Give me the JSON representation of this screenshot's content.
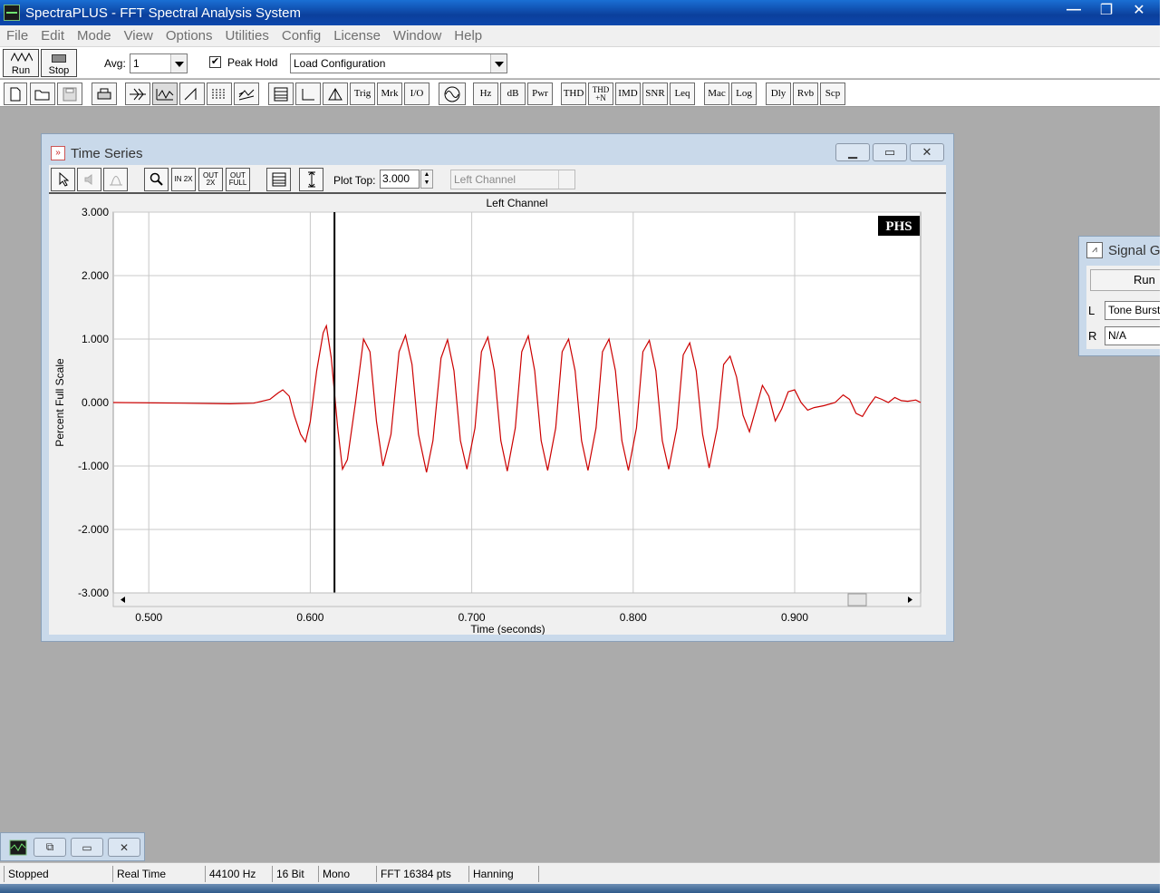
{
  "app": {
    "title": "SpectraPLUS - FFT Spectral Analysis System",
    "controls": {
      "minimize": "—",
      "restore": "❐",
      "close": "✕"
    }
  },
  "menu": [
    "File",
    "Edit",
    "Mode",
    "View",
    "Options",
    "Utilities",
    "Config",
    "License",
    "Window",
    "Help"
  ],
  "toolbar1": {
    "run_label": "Run",
    "stop_label": "Stop",
    "avg_label": "Avg:",
    "avg_value": "1",
    "peak_hold_label": "Peak Hold",
    "peak_hold_checked": "✔",
    "config_value": "Load Configuration"
  },
  "toolbar2": {
    "icons": [
      "new-file-icon",
      "open-folder-icon",
      "save-disk-icon",
      "print-icon",
      "spectrum-icon",
      "waveform-icon",
      "ramp-icon",
      "spectrogram-icon",
      "3d-surface-icon",
      "table-icon",
      "axis-icon",
      "triangle-icon"
    ],
    "text_buttons": [
      "Trig",
      "Mrk",
      "I/O"
    ],
    "sine_icon": "sine-icon",
    "text_buttons2": [
      "Hz",
      "dB",
      "Pwr"
    ],
    "text_buttons3": [
      "THD",
      "THD +N",
      "IMD",
      "SNR",
      "Leq"
    ],
    "text_buttons4": [
      "Mac",
      "Log"
    ],
    "text_buttons5": [
      "Dly",
      "Rvb",
      "Scp"
    ]
  },
  "time_series": {
    "title": "Time Series",
    "controls": {
      "minimize": "▁",
      "restore": "▭",
      "close": "✕"
    },
    "toolbar": {
      "zoom_in_label": "IN 2X",
      "zoom_out_label": "OUT 2X",
      "zoom_full_label": "OUT FULL",
      "plot_top_label": "Plot Top:",
      "plot_top_value": "3.000",
      "channel_value": "Left Channel"
    },
    "logo": "PHS"
  },
  "chart_data": {
    "type": "line",
    "title": "Left Channel",
    "xlabel": "Time (seconds)",
    "ylabel": "Percent Full Scale",
    "xlim": [
      0.478,
      0.978
    ],
    "ylim": [
      -3.0,
      3.0
    ],
    "x_ticks": [
      0.5,
      0.6,
      0.7,
      0.8,
      0.9
    ],
    "x_tick_labels": [
      "0.500",
      "0.600",
      "0.700",
      "0.800",
      "0.900"
    ],
    "y_ticks": [
      3,
      2,
      1,
      0,
      -1,
      -2,
      -3
    ],
    "y_tick_labels": [
      "3.000",
      "2.000",
      "1.000",
      "0.000",
      "-1.000",
      "-2.000",
      "-3.000"
    ],
    "grid": true,
    "cursor_x": 0.615,
    "series": [
      {
        "color": "#cc0000",
        "points": [
          [
            0.478,
            0.0
          ],
          [
            0.52,
            -0.01
          ],
          [
            0.55,
            -0.02
          ],
          [
            0.565,
            -0.01
          ],
          [
            0.575,
            0.05
          ],
          [
            0.58,
            0.15
          ],
          [
            0.583,
            0.2
          ],
          [
            0.587,
            0.1
          ],
          [
            0.59,
            -0.2
          ],
          [
            0.594,
            -0.5
          ],
          [
            0.597,
            -0.62
          ],
          [
            0.6,
            -0.3
          ],
          [
            0.604,
            0.5
          ],
          [
            0.608,
            1.1
          ],
          [
            0.61,
            1.21
          ],
          [
            0.613,
            0.7
          ],
          [
            0.617,
            -0.4
          ],
          [
            0.62,
            -1.05
          ],
          [
            0.623,
            -0.9
          ],
          [
            0.628,
            0.0
          ],
          [
            0.633,
            1.0
          ],
          [
            0.637,
            0.8
          ],
          [
            0.641,
            -0.3
          ],
          [
            0.645,
            -1.0
          ],
          [
            0.65,
            -0.5
          ],
          [
            0.655,
            0.8
          ],
          [
            0.659,
            1.06
          ],
          [
            0.663,
            0.6
          ],
          [
            0.667,
            -0.5
          ],
          [
            0.672,
            -1.1
          ],
          [
            0.676,
            -0.6
          ],
          [
            0.681,
            0.7
          ],
          [
            0.685,
            0.99
          ],
          [
            0.689,
            0.5
          ],
          [
            0.693,
            -0.6
          ],
          [
            0.697,
            -1.05
          ],
          [
            0.702,
            -0.4
          ],
          [
            0.706,
            0.8
          ],
          [
            0.71,
            1.03
          ],
          [
            0.714,
            0.5
          ],
          [
            0.718,
            -0.6
          ],
          [
            0.722,
            -1.08
          ],
          [
            0.727,
            -0.4
          ],
          [
            0.731,
            0.8
          ],
          [
            0.735,
            1.05
          ],
          [
            0.739,
            0.5
          ],
          [
            0.743,
            -0.6
          ],
          [
            0.747,
            -1.07
          ],
          [
            0.752,
            -0.4
          ],
          [
            0.756,
            0.8
          ],
          [
            0.76,
            1.0
          ],
          [
            0.764,
            0.5
          ],
          [
            0.768,
            -0.6
          ],
          [
            0.772,
            -1.07
          ],
          [
            0.777,
            -0.4
          ],
          [
            0.781,
            0.8
          ],
          [
            0.785,
            1.0
          ],
          [
            0.789,
            0.5
          ],
          [
            0.793,
            -0.6
          ],
          [
            0.797,
            -1.07
          ],
          [
            0.802,
            -0.4
          ],
          [
            0.806,
            0.8
          ],
          [
            0.81,
            0.98
          ],
          [
            0.814,
            0.5
          ],
          [
            0.818,
            -0.6
          ],
          [
            0.822,
            -1.05
          ],
          [
            0.827,
            -0.4
          ],
          [
            0.831,
            0.75
          ],
          [
            0.835,
            0.94
          ],
          [
            0.839,
            0.5
          ],
          [
            0.843,
            -0.5
          ],
          [
            0.847,
            -1.03
          ],
          [
            0.852,
            -0.4
          ],
          [
            0.856,
            0.6
          ],
          [
            0.86,
            0.73
          ],
          [
            0.864,
            0.4
          ],
          [
            0.868,
            -0.2
          ],
          [
            0.872,
            -0.46
          ],
          [
            0.876,
            -0.1
          ],
          [
            0.88,
            0.27
          ],
          [
            0.884,
            0.1
          ],
          [
            0.888,
            -0.29
          ],
          [
            0.892,
            -0.1
          ],
          [
            0.896,
            0.17
          ],
          [
            0.9,
            0.2
          ],
          [
            0.904,
            0.0
          ],
          [
            0.908,
            -0.12
          ],
          [
            0.912,
            -0.08
          ],
          [
            0.918,
            -0.05
          ],
          [
            0.925,
            0.0
          ],
          [
            0.93,
            0.12
          ],
          [
            0.934,
            0.05
          ],
          [
            0.938,
            -0.17
          ],
          [
            0.942,
            -0.22
          ],
          [
            0.946,
            -0.05
          ],
          [
            0.95,
            0.09
          ],
          [
            0.954,
            0.05
          ],
          [
            0.958,
            0.0
          ],
          [
            0.962,
            0.08
          ],
          [
            0.966,
            0.03
          ],
          [
            0.97,
            0.02
          ],
          [
            0.975,
            0.04
          ],
          [
            0.978,
            0.0
          ]
        ]
      }
    ]
  },
  "signal_generator": {
    "title": "Signal Gen",
    "run_label": "Run",
    "left_label": "L",
    "left_value": "Tone Burst",
    "right_label": "R",
    "right_value": "N/A"
  },
  "mini_window": {
    "restore": "⧉",
    "maximize": "▭",
    "close": "✕"
  },
  "status": [
    "Stopped",
    "Real Time",
    "44100 Hz",
    "16 Bit",
    "Mono",
    "FFT 16384 pts",
    "Hanning"
  ]
}
